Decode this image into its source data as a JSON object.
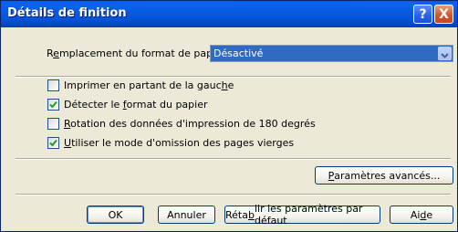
{
  "window": {
    "title": "Détails de finition",
    "help_glyph": "?",
    "close_glyph": "X"
  },
  "paper_format": {
    "label_pre": "R",
    "label_accel": "e",
    "label_post": "mplacement du format de papier :",
    "value": "Désactivé"
  },
  "options": [
    {
      "pre": "Imprimer en partant de la gauc",
      "accel": "h",
      "post": "e",
      "checked": false
    },
    {
      "pre": "Détecter le ",
      "accel": "f",
      "post": "ormat du papier",
      "checked": true
    },
    {
      "pre": "",
      "accel": "R",
      "post": "otation des données d'impression de 180 degrés",
      "checked": false
    },
    {
      "pre": "",
      "accel": "U",
      "post": "tiliser le mode d'omission des pages vierges",
      "checked": true
    }
  ],
  "buttons": {
    "advanced": {
      "pre": "",
      "accel": "P",
      "post": "aramètres avancés..."
    },
    "ok": "OK",
    "cancel": "Annuler",
    "reset": {
      "pre": "Réta",
      "accel": "b",
      "post": "lir les paramètres par défaut"
    },
    "help": {
      "pre": "Ai",
      "accel": "d",
      "post": "e"
    }
  },
  "colors": {
    "title_bar": "#0A5BE1",
    "selection": "#316AC5",
    "dialog_bg": "#ECE9D8",
    "check_mark": "#21A121"
  }
}
